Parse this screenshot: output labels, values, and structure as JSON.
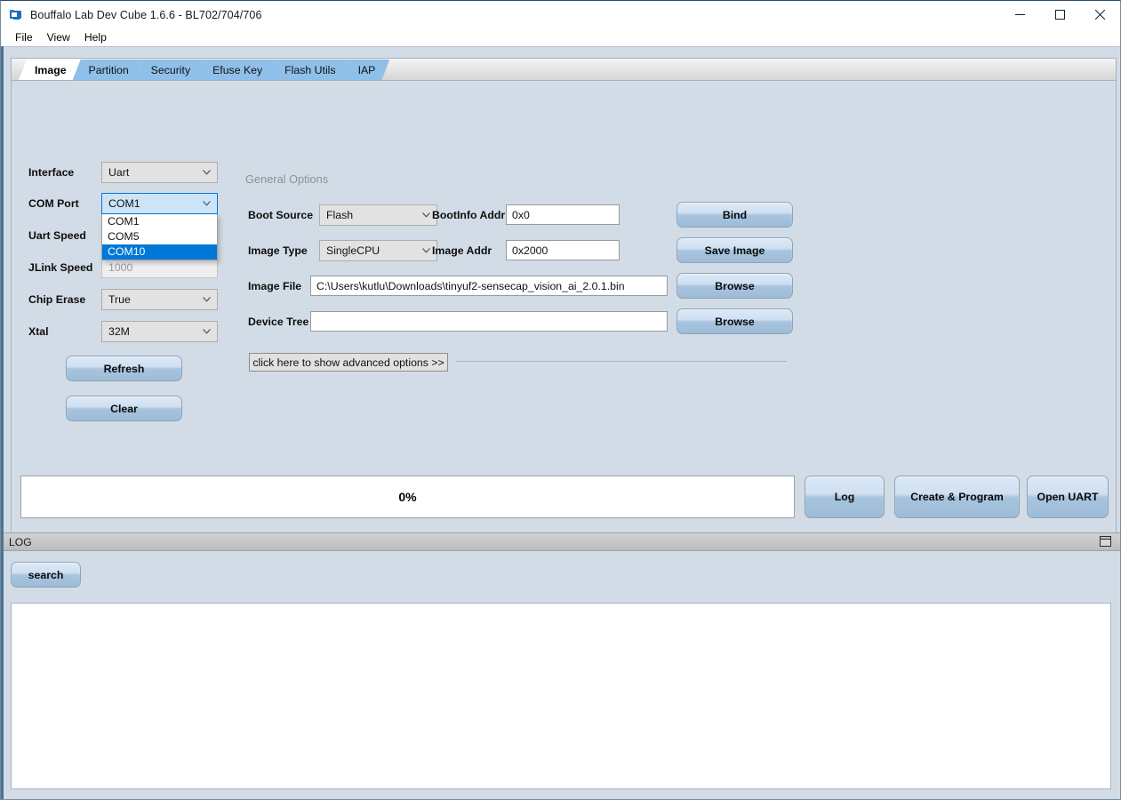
{
  "window": {
    "title": "Bouffalo Lab Dev Cube 1.6.6 - BL702/704/706",
    "icon": "app-logo-icon",
    "minimize": "minimize-icon",
    "maximize": "maximize-icon",
    "close": "close-icon"
  },
  "menu": {
    "items": [
      {
        "label": "File"
      },
      {
        "label": "View"
      },
      {
        "label": "Help"
      }
    ]
  },
  "tabs": [
    {
      "label": "Image",
      "active": true
    },
    {
      "label": "Partition",
      "active": false
    },
    {
      "label": "Security",
      "active": false
    },
    {
      "label": "Efuse Key",
      "active": false
    },
    {
      "label": "Flash Utils",
      "active": false
    },
    {
      "label": "IAP",
      "active": false
    }
  ],
  "left_form": {
    "fields": [
      {
        "label": "Interface",
        "value": "Uart",
        "type": "combo",
        "state": "enabled"
      },
      {
        "label": "COM Port",
        "value": "COM1",
        "type": "combo",
        "state": "open"
      },
      {
        "label": "Uart Speed",
        "value": "",
        "type": "combo",
        "state": "hidden"
      },
      {
        "label": "JLink Speed",
        "value": "1000",
        "type": "text",
        "state": "disabled"
      },
      {
        "label": "Chip Erase",
        "value": "True",
        "type": "combo",
        "state": "enabled"
      },
      {
        "label": "Xtal",
        "value": "32M",
        "type": "combo",
        "state": "enabled"
      }
    ],
    "com_port_options": [
      {
        "label": "COM1",
        "selected": false
      },
      {
        "label": "COM5",
        "selected": false
      },
      {
        "label": "COM10",
        "selected": true
      }
    ],
    "buttons": [
      {
        "label": "Refresh"
      },
      {
        "label": "Clear"
      }
    ]
  },
  "general_options": {
    "title": "General Options",
    "boot_source": {
      "label": "Boot Source",
      "value": "Flash"
    },
    "bootinfo_addr": {
      "label": "BootInfo Addr",
      "value": "0x0"
    },
    "image_type": {
      "label": "Image Type",
      "value": "SingleCPU"
    },
    "image_addr": {
      "label": "Image Addr",
      "value": "0x2000"
    },
    "image_file": {
      "label": "Image File",
      "value": "C:\\Users\\kutlu\\Downloads\\tinyuf2-sensecap_vision_ai_2.0.1.bin"
    },
    "device_tree": {
      "label": "Device Tree",
      "value": ""
    },
    "advanced_toggle": "click here to show advanced options >>",
    "side_buttons": [
      {
        "label": "Bind"
      },
      {
        "label": "Save Image"
      },
      {
        "label": "Browse"
      },
      {
        "label": "Browse"
      }
    ]
  },
  "status": {
    "progress_text": "0%",
    "progress_percent": 0,
    "action_buttons": [
      {
        "label": "Log"
      },
      {
        "label": "Create & Program"
      },
      {
        "label": "Open UART"
      }
    ]
  },
  "log_panel": {
    "header": "LOG",
    "restore_icon": "restore-window-icon",
    "search_button": "search",
    "content": ""
  },
  "colors": {
    "background": "#d2dce6",
    "accent_blue": "#0078d7",
    "tab_blue": "#8fc0ea",
    "button_blue": "#a8c4de"
  }
}
